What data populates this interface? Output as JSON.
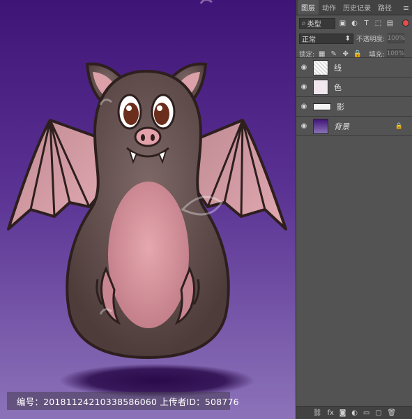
{
  "panel": {
    "tabs": [
      {
        "label": "图层"
      },
      {
        "label": "动作"
      },
      {
        "label": "历史记录"
      },
      {
        "label": "路径"
      }
    ],
    "filter": {
      "label": "类型"
    },
    "blend_mode": "正常",
    "opacity_label": "不透明度:",
    "opacity_value": "100%",
    "lock_label": "锁定:",
    "fill_label": "填充:",
    "fill_value": "100%",
    "layers": [
      {
        "name": "线",
        "visible": true,
        "locked": false
      },
      {
        "name": "色",
        "visible": true,
        "locked": false
      },
      {
        "name": "影",
        "visible": true,
        "locked": false
      },
      {
        "name": "背景",
        "visible": true,
        "locked": true
      }
    ]
  },
  "caption": "编号：20181124210338586060 上传者ID：508776",
  "colors": {
    "bg_top": "#3f1477",
    "bg_bottom": "#8c73b9",
    "bat_body": "#6b5553",
    "bat_belly": "#d7909a",
    "panel_bg": "#535353"
  }
}
